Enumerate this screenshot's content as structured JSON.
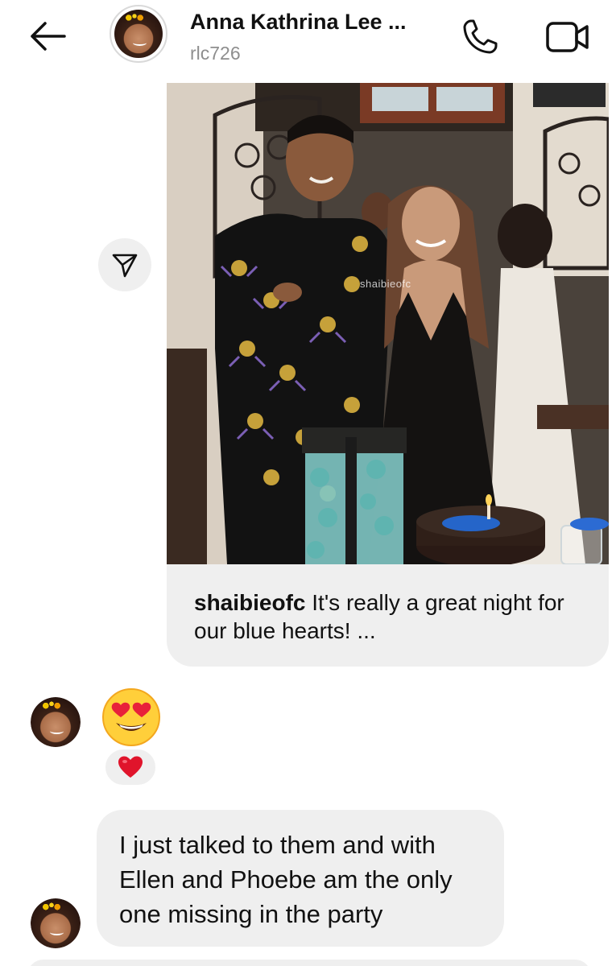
{
  "header": {
    "contact_name": "Anna Kathrina Lee ...",
    "username": "rlc726",
    "icons": {
      "back": "back-arrow-icon",
      "call": "phone-icon",
      "video": "video-camera-icon"
    }
  },
  "shared_post": {
    "watermark": "shaibieofc",
    "caption_author": "shaibieofc",
    "caption_text": " It's really a great night for our blue hearts! ...",
    "share_icon": "paper-plane-icon"
  },
  "messages": [
    {
      "type": "emoji",
      "content": "😍",
      "reaction": "❤️"
    },
    {
      "type": "text",
      "content": "I just talked to them and with Ellen and Phoebe am the only one missing in the party"
    }
  ],
  "colors": {
    "bubble": "#efefef",
    "secondary_text": "#8e8e8e",
    "heart": "#e0142b"
  }
}
